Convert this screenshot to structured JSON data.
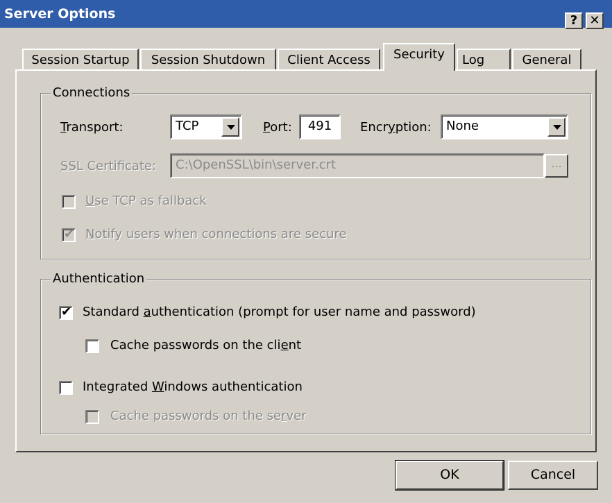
{
  "window": {
    "title": "Server Options",
    "help_label": "?",
    "close_label": "✕"
  },
  "tabs": [
    {
      "label": "Session Startup"
    },
    {
      "label": "Session Shutdown"
    },
    {
      "label": "Client Access"
    },
    {
      "label": "Security",
      "active": true
    },
    {
      "label": "Log"
    },
    {
      "label": "General"
    }
  ],
  "connections": {
    "group_label": "Connections",
    "transport_label_underline": "T",
    "transport_label_rest": "ransport:",
    "transport_value": "TCP",
    "port_label_underline": "P",
    "port_label_rest": "ort:",
    "port_value": "491",
    "encryption_label_pre": "Encr",
    "encryption_label_underline": "y",
    "encryption_label_rest": "ption:",
    "encryption_value": "None",
    "ssl_label_underline": "S",
    "ssl_label_rest": "SL Certificate:",
    "ssl_value": "C:\\OpenSSL\\bin\\server.crt",
    "browse_label": "...",
    "fallback_underline": "U",
    "fallback_rest": "se TCP as fallback",
    "fallback_checked": false,
    "notify_underline": "N",
    "notify_rest": "otify users when connections are secure",
    "notify_checked": true
  },
  "authentication": {
    "group_label": "Authentication",
    "standard_pre": "Standard ",
    "standard_underline": "a",
    "standard_rest": "uthentication (prompt for user name and password)",
    "standard_checked": true,
    "cache_client_pre": "Cache passwords on the cli",
    "cache_client_underline": "e",
    "cache_client_rest": "nt",
    "cache_client_checked": false,
    "integrated_pre": "Integrated ",
    "integrated_underline": "W",
    "integrated_rest": "indows authentication",
    "integrated_checked": false,
    "cache_server_pre": "Cache passwords on the se",
    "cache_server_underline": "r",
    "cache_server_rest": "ver",
    "cache_server_checked": false
  },
  "buttons": {
    "ok": "OK",
    "cancel": "Cancel"
  },
  "icons": {
    "check": "✔"
  }
}
